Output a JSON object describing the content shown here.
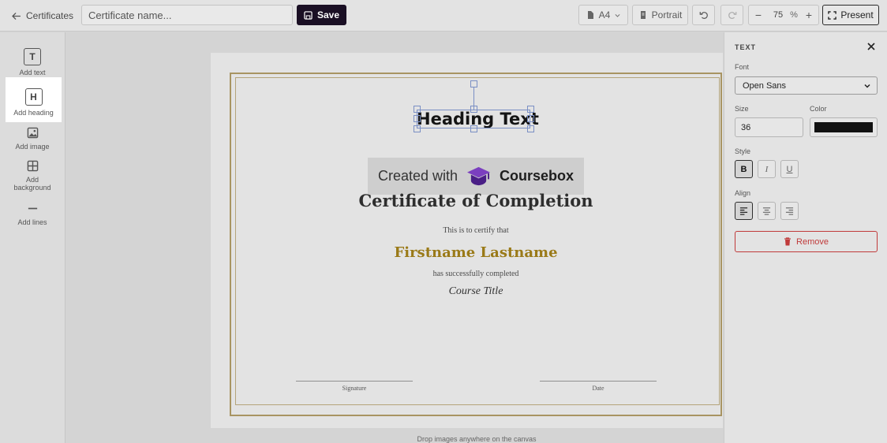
{
  "topbar": {
    "back_label": "Certificates",
    "name_placeholder": "Certificate name...",
    "save_label": "Save",
    "page_size": "A4",
    "orientation": "Portrait",
    "zoom_value": "75",
    "zoom_unit": "%",
    "zoom_minus": "−",
    "zoom_plus": "+",
    "present_label": "Present"
  },
  "sidebar": {
    "items": [
      {
        "label": "Add text",
        "glyph": "T",
        "icon": "text-icon"
      },
      {
        "label": "Add heading",
        "glyph": "H",
        "icon": "heading-icon"
      },
      {
        "label": "Add image",
        "icon": "image-icon"
      },
      {
        "label": "Add background",
        "icon": "grid-icon"
      },
      {
        "label": "Add lines",
        "icon": "line-icon"
      }
    ],
    "active_index": 1
  },
  "canvas": {
    "heading_text": "Heading Text",
    "watermark_prefix": "Created with",
    "watermark_brand": "Coursebox",
    "title": "Certificate of Completion",
    "certify_line": "This is to certify that",
    "recipient_name": "Firstname Lastname",
    "completed_line": "has successfully completed",
    "course_title": "Course Title",
    "signature_label": "Signature",
    "date_label": "Date",
    "drop_hint": "Drop images anywhere on the canvas",
    "border_color": "#a89462",
    "recipient_color": "#9a7a18"
  },
  "panel": {
    "title": "TEXT",
    "font_label": "Font",
    "font_value": "Open Sans",
    "size_label": "Size",
    "size_value": "36",
    "color_label": "Color",
    "color_value": "#111111",
    "style_label": "Style",
    "style_bold": "B",
    "style_italic": "I",
    "style_underline": "U",
    "align_label": "Align",
    "remove_label": "Remove",
    "remove_color": "#c03a3a"
  }
}
